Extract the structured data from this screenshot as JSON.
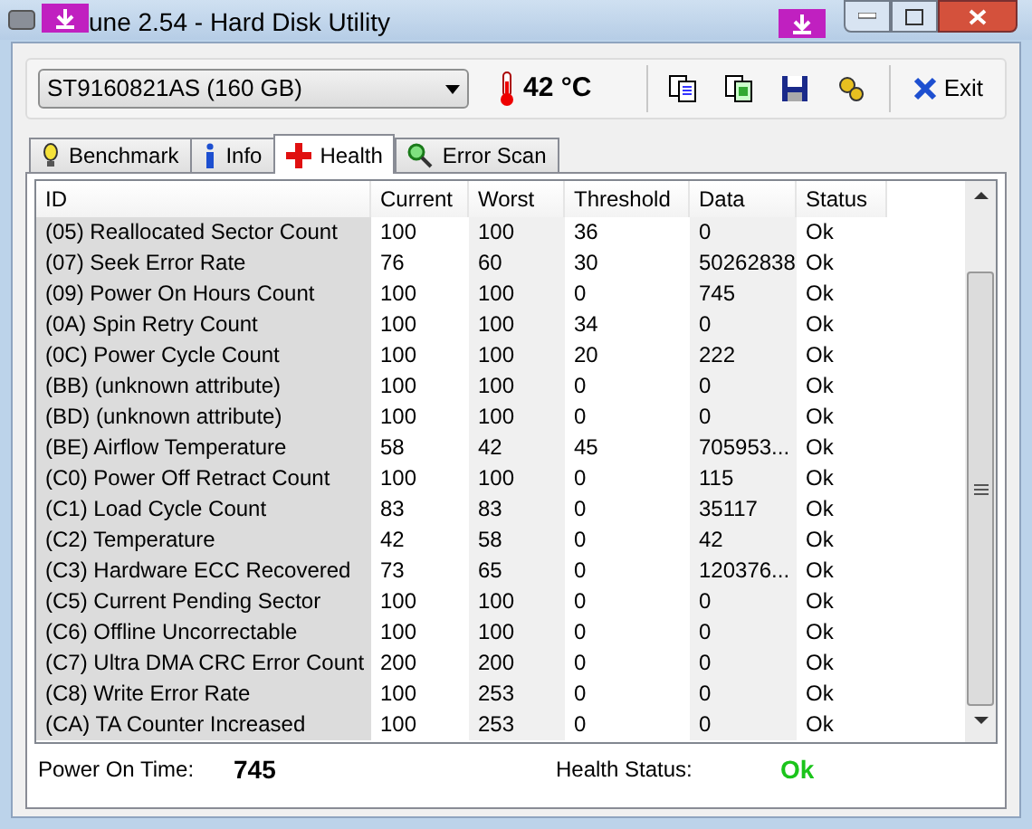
{
  "window": {
    "title": "une 2.54 - Hard Disk Utility"
  },
  "drive": {
    "value": "ST9160821AS (160 GB)"
  },
  "temperature": "42 °C",
  "exit_button": "Exit",
  "tabs": [
    {
      "label": "Benchmark",
      "selected": false,
      "kind": "bulb"
    },
    {
      "label": "Info",
      "selected": false,
      "kind": "info"
    },
    {
      "label": "Health",
      "selected": true,
      "kind": "cross"
    },
    {
      "label": "Error Scan",
      "selected": false,
      "kind": "magnifier"
    }
  ],
  "table": {
    "columns": [
      "ID",
      "Current",
      "Worst",
      "Threshold",
      "Data",
      "Status"
    ],
    "rows": [
      [
        "(05) Reallocated Sector Count",
        "100",
        "100",
        "36",
        "0",
        "Ok"
      ],
      [
        "(07) Seek Error Rate",
        "76",
        "60",
        "30",
        "50262838",
        "Ok"
      ],
      [
        "(09) Power On Hours Count",
        "100",
        "100",
        "0",
        "745",
        "Ok"
      ],
      [
        "(0A) Spin Retry Count",
        "100",
        "100",
        "34",
        "0",
        "Ok"
      ],
      [
        "(0C) Power Cycle Count",
        "100",
        "100",
        "20",
        "222",
        "Ok"
      ],
      [
        "(BB) (unknown attribute)",
        "100",
        "100",
        "0",
        "0",
        "Ok"
      ],
      [
        "(BD) (unknown attribute)",
        "100",
        "100",
        "0",
        "0",
        "Ok"
      ],
      [
        "(BE) Airflow Temperature",
        "58",
        "42",
        "45",
        "705953...",
        "Ok"
      ],
      [
        "(C0) Power Off Retract Count",
        "100",
        "100",
        "0",
        "115",
        "Ok"
      ],
      [
        "(C1) Load Cycle Count",
        "83",
        "83",
        "0",
        "35117",
        "Ok"
      ],
      [
        "(C2) Temperature",
        "42",
        "58",
        "0",
        "42",
        "Ok"
      ],
      [
        "(C3) Hardware ECC Recovered",
        "73",
        "65",
        "0",
        "120376...",
        "Ok"
      ],
      [
        "(C5) Current Pending Sector",
        "100",
        "100",
        "0",
        "0",
        "Ok"
      ],
      [
        "(C6) Offline Uncorrectable",
        "100",
        "100",
        "0",
        "0",
        "Ok"
      ],
      [
        "(C7) Ultra DMA CRC Error Count",
        "200",
        "200",
        "0",
        "0",
        "Ok"
      ],
      [
        "(C8) Write Error Rate",
        "100",
        "253",
        "0",
        "0",
        "Ok"
      ],
      [
        "(CA) TA Counter Increased",
        "100",
        "253",
        "0",
        "0",
        "Ok"
      ]
    ]
  },
  "footer": {
    "power_on_label": "Power On Time:",
    "power_on_value": "745",
    "health_label": "Health Status:",
    "health_value": "Ok"
  }
}
